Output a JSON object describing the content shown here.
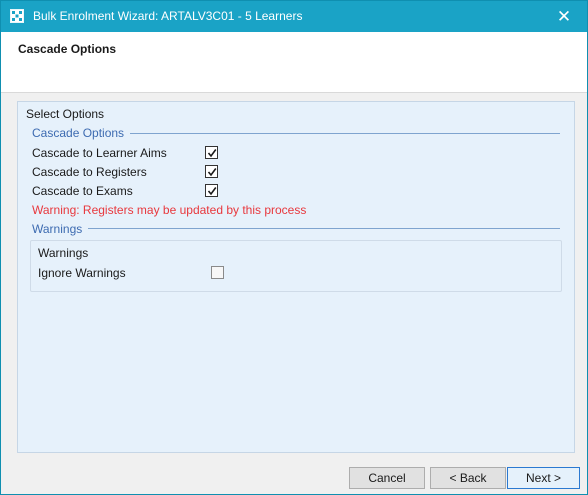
{
  "window": {
    "title": "Bulk Enrolment Wizard: ARTALV3C01 - 5 Learners",
    "close_glyph": "✕"
  },
  "header": {
    "title": "Cascade Options"
  },
  "main": {
    "section_label": "Select Options",
    "cascade_group": {
      "title": "Cascade Options",
      "options": [
        {
          "label": "Cascade to Learner Aims",
          "checked": true
        },
        {
          "label": "Cascade to Registers",
          "checked": true
        },
        {
          "label": "Cascade to Exams",
          "checked": true
        }
      ],
      "warning": "Warning: Registers may be updated by this process"
    },
    "warnings_group": {
      "title": "Warnings",
      "box_title": "Warnings",
      "option": {
        "label": "Ignore Warnings",
        "checked": false
      }
    }
  },
  "footer": {
    "cancel_label": "Cancel",
    "back_label": "< Back",
    "next_label": "Next >"
  },
  "colors": {
    "titlebar": "#1aa3c6",
    "group_header": "#3d6bb1",
    "warning": "#e8383d",
    "panel": "#e6f1fb"
  }
}
